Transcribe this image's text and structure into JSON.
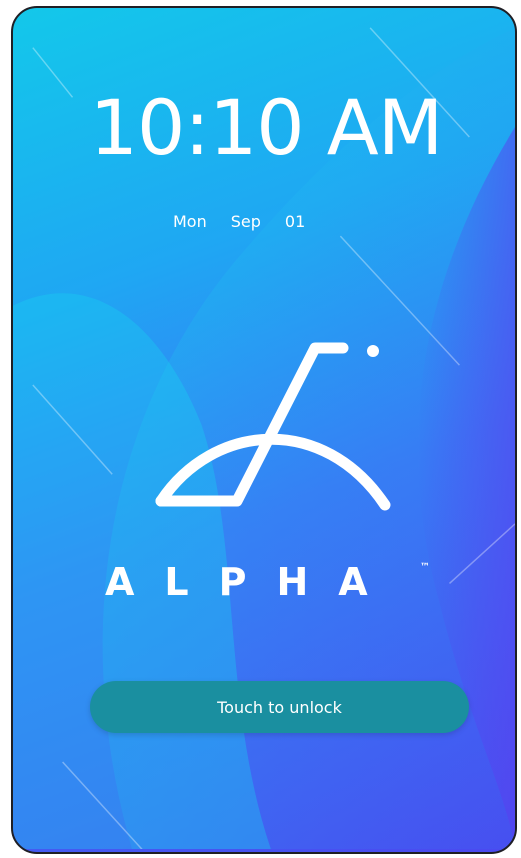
{
  "lockscreen": {
    "time": "10:10 AM",
    "date": {
      "weekday": "Mon",
      "month": "Sep",
      "day": "01"
    },
    "brand": {
      "name": "ALPHA",
      "trademark": "™"
    },
    "unlock_label": "Touch to unlock"
  },
  "colors": {
    "gradient_start": "#13c8ea",
    "gradient_end": "#4a49f0",
    "unlock_button": "#1a8fa0",
    "text": "#ffffff"
  },
  "icons": {
    "logo": "alpha-logo-icon"
  }
}
